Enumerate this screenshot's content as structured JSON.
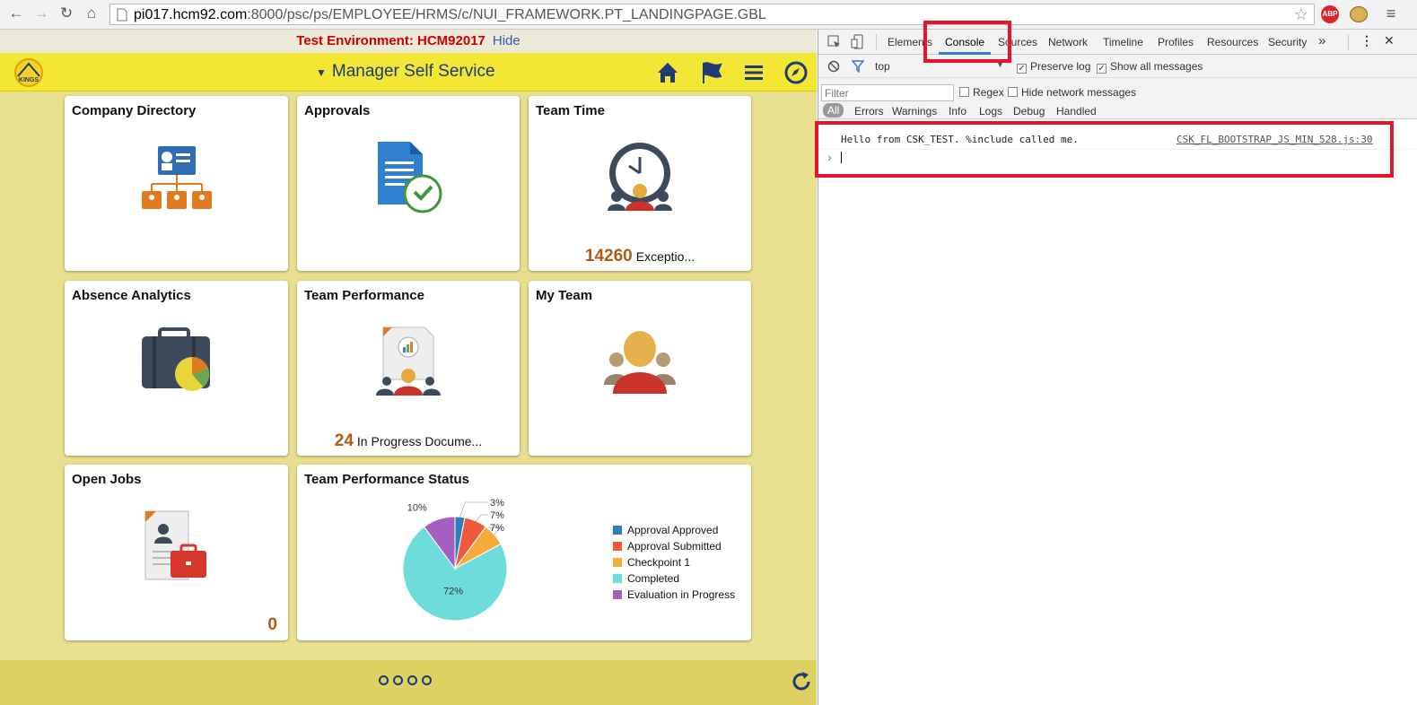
{
  "browser": {
    "url_host": "pi017.hcm92.com",
    "url_rest": ":8000/psc/ps/EMPLOYEE/HRMS/c/NUI_FRAMEWORK.PT_LANDINGPAGE.GBL",
    "ext_abp": "ABP"
  },
  "app": {
    "test_env": "Test Environment: HCM92017",
    "hide": "Hide",
    "title": "Manager Self Service",
    "tiles": [
      {
        "title": "Company Directory"
      },
      {
        "title": "Approvals"
      },
      {
        "title": "Team Time",
        "count": "14260",
        "count_label": "Exceptio..."
      },
      {
        "title": "Absence Analytics"
      },
      {
        "title": "Team Performance",
        "count": "24",
        "count_label": "In Progress Docume..."
      },
      {
        "title": "My Team"
      },
      {
        "title": "Open Jobs",
        "count": "0"
      },
      {
        "title": "Team Performance Status"
      }
    ]
  },
  "chart_data": {
    "type": "pie",
    "categories": [
      "Approval Approved",
      "Approval Submitted",
      "Checkpoint 1",
      "Completed",
      "Evaluation in Progress"
    ],
    "values": [
      3,
      7,
      7,
      72,
      10
    ],
    "labels": [
      "3%",
      "7%",
      "7%",
      "72%",
      "10%"
    ],
    "colors": [
      "#2c7fb8",
      "#f05a3c",
      "#f8aa3c",
      "#6fdcdc",
      "#a45ec0"
    ],
    "legend": "right"
  },
  "devtools": {
    "tabs": [
      "Elements",
      "Console",
      "Sources",
      "Network",
      "Timeline",
      "Profiles",
      "Resources",
      "Security"
    ],
    "more": "»",
    "context": "top",
    "preserve_log": "Preserve log",
    "show_all": "Show all messages",
    "filter_placeholder": "Filter",
    "regex": "Regex",
    "hide_network": "Hide network messages",
    "levels": [
      "All",
      "Errors",
      "Warnings",
      "Info",
      "Logs",
      "Debug",
      "Handled"
    ],
    "message": "Hello from CSK_TEST. %include called me.",
    "source": "CSK_FL_BOOTSTRAP_JS_MIN_528.js:30",
    "prompt": "›"
  }
}
